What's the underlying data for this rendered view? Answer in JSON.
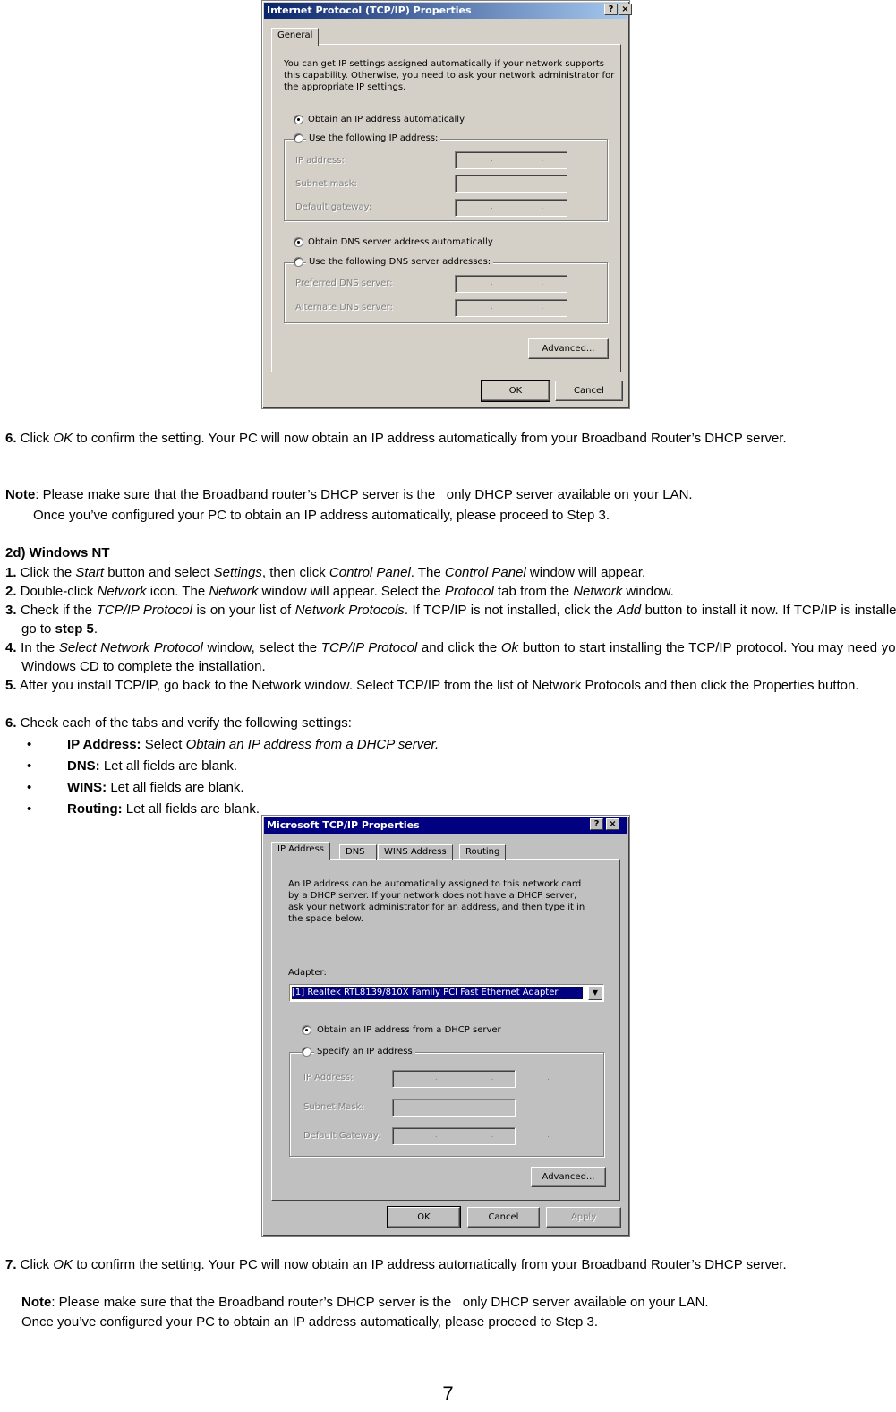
{
  "dialog_xp": {
    "title": "Internet Protocol (TCP/IP) Properties",
    "title_colors": {
      "from": "#0a246a",
      "to": "#a6caf0"
    },
    "help_button": "?",
    "close_button": "×",
    "tabs": [
      "General"
    ],
    "intro": [
      "You can get IP settings assigned automatically if your network supports",
      "this capability. Otherwise, you need to ask your network administrator for",
      "the appropriate IP settings."
    ],
    "radio_auto_ip": "Obtain an IP address automatically",
    "radio_manual_ip": "Use the following IP address:",
    "ip_fields": [
      {
        "label": "IP address:",
        "value": " .  .  ."
      },
      {
        "label": "Subnet mask:",
        "value": " .  .  ."
      },
      {
        "label": "Default gateway:",
        "value": " .  .  ."
      }
    ],
    "radio_auto_dns": "Obtain DNS server address automatically",
    "radio_manual_dns": "Use the following DNS server addresses:",
    "dns_fields": [
      {
        "label": "Preferred DNS server:",
        "value": " .  .  ."
      },
      {
        "label": "Alternate DNS server:",
        "value": " .  .  ."
      }
    ],
    "advanced_button": "Advanced...",
    "ok_button": "OK",
    "cancel_button": "Cancel",
    "selected_ip_mode": "automatic",
    "selected_dns_mode": "automatic"
  },
  "step6": {
    "num": "6.",
    "pre": " Click ",
    "ok": "OK",
    "post": " to confirm the setting. Your PC will now obtain an IP address automatically from your Broadband Router’s DHCP server."
  },
  "note1": {
    "label": "Note",
    "line1": ": Please make sure that the Broadband router’s DHCP server is the   only DHCP server available on your LAN.",
    "line2": "Once you’ve configured your PC to obtain an IP address automatically, please proceed to Step 3."
  },
  "nt": {
    "heading": "2d) Windows NT",
    "steps": [
      {
        "num": "1.",
        "parts": [
          [
            "",
            " Click the "
          ],
          [
            "i",
            "Start"
          ],
          [
            "",
            " button and select "
          ],
          [
            "i",
            "Settings"
          ],
          [
            "",
            ", then click "
          ],
          [
            "i",
            "Control Panel"
          ],
          [
            "",
            ". The "
          ],
          [
            "i",
            "Control Panel"
          ],
          [
            "",
            " window will appear."
          ]
        ]
      },
      {
        "num": "2.",
        "parts": [
          [
            "",
            " Double-click "
          ],
          [
            "i",
            "Network"
          ],
          [
            "",
            " icon. The "
          ],
          [
            "i",
            "Network"
          ],
          [
            "",
            " window will appear. Select the "
          ],
          [
            "i",
            "Protocol"
          ],
          [
            "",
            " tab from the "
          ],
          [
            "i",
            "Network"
          ],
          [
            "",
            " window."
          ]
        ]
      },
      {
        "num": "3.",
        "parts": [
          [
            "",
            " Check if the "
          ],
          [
            "i",
            "TCP/IP Protocol"
          ],
          [
            "",
            " is on your list of "
          ],
          [
            "i",
            "Network Protocols"
          ],
          [
            "",
            ". If TCP/IP is not installed, click the "
          ],
          [
            "i",
            "Add"
          ],
          [
            "",
            " button to install it now. If TCP/IP is installed, go to "
          ],
          [
            "b",
            "step 5"
          ],
          [
            "",
            "."
          ]
        ]
      },
      {
        "num": "4.",
        "parts": [
          [
            "",
            " In the "
          ],
          [
            "i",
            "Select Network Protocol"
          ],
          [
            "",
            " window, select the "
          ],
          [
            "i",
            "TCP/IP Protocol"
          ],
          [
            "",
            " and click the "
          ],
          [
            "i",
            "Ok"
          ],
          [
            "",
            " button to start installing the TCP/IP protocol. You may need your Windows CD to complete the installation."
          ]
        ]
      },
      {
        "num": "5.",
        "parts": [
          [
            "",
            " After you install TCP/IP, go back to the Network window. Select TCP/IP from the list of Network Protocols and then click the Properties button."
          ]
        ]
      },
      {
        "num": "6.",
        "parts": [
          [
            "",
            " Check each of the tabs and verify the following settings:"
          ]
        ]
      }
    ],
    "bullets": [
      {
        "bold": "IP Address:",
        "text": " Select ",
        "ital": "Obtain an IP address from a DHCP server."
      },
      {
        "bold": "DNS:",
        "text": " Let all fields are blank.",
        "ital": ""
      },
      {
        "bold": "WINS:",
        "text": " Let all fields are blank.",
        "ital": ""
      },
      {
        "bold": "Routing:",
        "text": " Let all fields are blank.",
        "ital": ""
      }
    ],
    "bullet_glyph": "•"
  },
  "dialog_nt": {
    "title": "Microsoft TCP/IP Properties",
    "title_color": "#000080",
    "help_button": "?",
    "close_button": "×",
    "tabs": [
      "IP Address",
      "DNS",
      "WINS Address",
      "Routing"
    ],
    "active_tab": "IP Address",
    "intro": [
      "An IP address can be automatically assigned to this network card",
      "by a DHCP server.  If your network does not have a DHCP server,",
      "ask your network administrator for an address, and then type it in",
      "the space below."
    ],
    "adapter_label": "Adapter:",
    "adapter_value": "[1] Realtek RTL8139/810X Family PCI Fast Ethernet Adapter",
    "radio_dhcp": "Obtain an IP address from a DHCP server",
    "radio_specify": "Specify an IP address",
    "fields": [
      {
        "label": "IP Address:",
        "value": " .  .  ."
      },
      {
        "label": "Subnet Mask:",
        "value": " .  .  ."
      },
      {
        "label": "Default Gateway:",
        "value": " .  .  ."
      }
    ],
    "advanced_button": "Advanced...",
    "ok_button": "OK",
    "cancel_button": "Cancel",
    "apply_button": "Apply",
    "selected_mode": "dhcp"
  },
  "step7": {
    "num": "7.",
    "pre": " Click ",
    "ok": "OK",
    "post": " to confirm the setting. Your PC will now obtain an IP address automatically from your Broadband Router’s DHCP server."
  },
  "note2": {
    "label": "Note",
    "line1": ": Please make sure that the Broadband router’s DHCP server is the   only DHCP server available on your LAN.",
    "line2": "Once you’ve configured your PC to obtain an IP address automatically, please proceed to Step 3."
  },
  "page_number": "7"
}
